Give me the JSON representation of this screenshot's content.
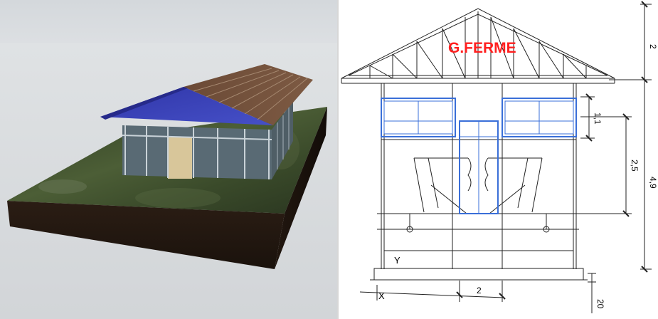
{
  "drawing": {
    "brand_label": "G.FERME",
    "dimensions": {
      "truss_height": "2",
      "total_height": "4,9",
      "opening_height": "2,5",
      "window_height": "1,1",
      "bay_width": "2",
      "plinth": "20"
    },
    "axis_labels": {
      "x": "X",
      "y": "Y"
    },
    "colors": {
      "brand": "#ff1f1f",
      "window_frame": "#3a6fd8",
      "roof_3d": "#3b3eb8",
      "lines": "#222222"
    }
  }
}
